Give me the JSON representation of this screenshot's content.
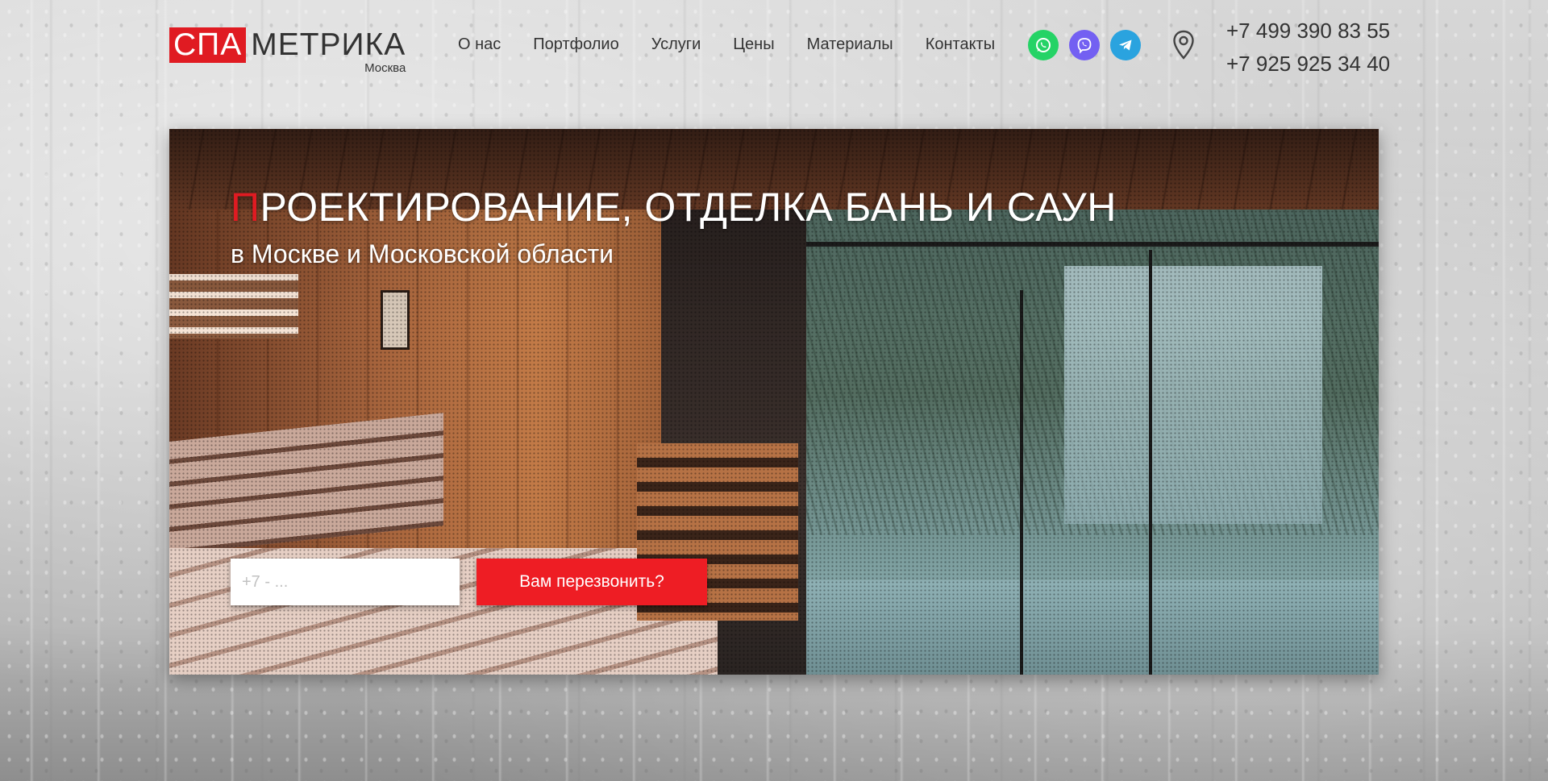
{
  "logo": {
    "spa": "СПА",
    "rest": "МЕТРИКА",
    "city": "Москва"
  },
  "nav": [
    "О нас",
    "Портфолио",
    "Услуги",
    "Цены",
    "Материалы",
    "Контакты"
  ],
  "messengers": [
    {
      "name": "whatsapp",
      "color": "#25d366"
    },
    {
      "name": "viber",
      "color": "#7360f2"
    },
    {
      "name": "telegram",
      "color": "#2aa3df"
    }
  ],
  "location_icon": "map-pin-icon",
  "phones": [
    "+7 499 390 83 55",
    "+7 925 925 34 40"
  ],
  "hero": {
    "title_first_letter": "П",
    "title_rest": "РОЕКТИРОВАНИЕ, ОТДЕЛКА БАНЬ И САУН",
    "subtitle": "в Москве и Московской области",
    "phone_placeholder": "+7 - ...",
    "callback_label": "Вам перезвонить?"
  },
  "colors": {
    "accent": "#e01b22",
    "button": "#ee1d24",
    "text": "#333333"
  }
}
